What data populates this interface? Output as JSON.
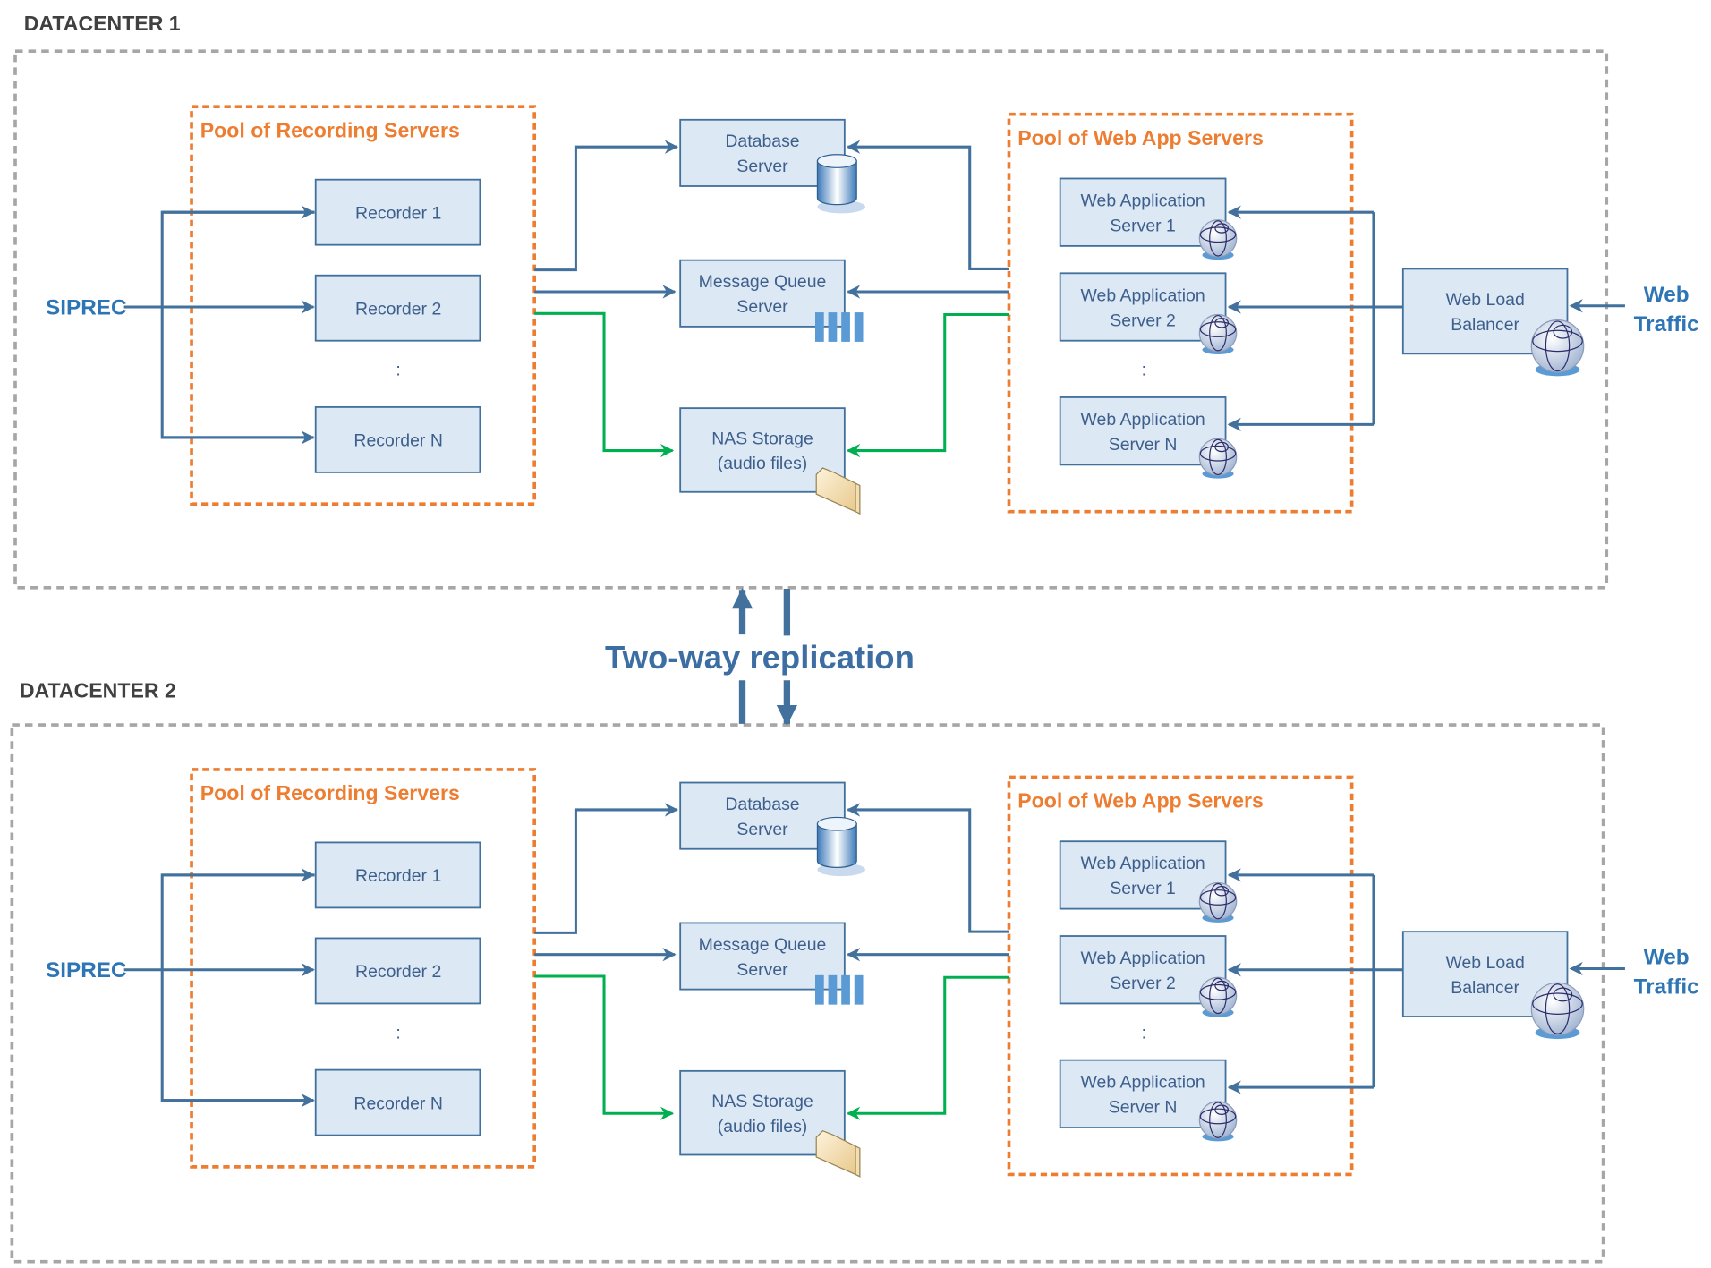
{
  "replication_label": "Two-way replication",
  "colors": {
    "connector_blue": "#41719c",
    "connector_green": "#00b050",
    "pool_border_orange": "#ed7d31",
    "datacenter_border_gray": "#a6a6a6",
    "box_fill": "#dde8f5",
    "label_blue": "#2e75b6"
  },
  "datacenters": [
    {
      "label": "DATACENTER 1",
      "siprec": "SIPREC",
      "web_traffic": [
        "Web",
        "Traffic"
      ],
      "recording_pool": {
        "title": "Pool of Recording Servers",
        "recorders": [
          "Recorder 1",
          "Recorder 2",
          "Recorder N"
        ],
        "ellipsis": ":"
      },
      "database": {
        "lines": [
          "Database",
          "Server"
        ],
        "icon": "database-cylinder-icon"
      },
      "message_queue": {
        "lines": [
          "Message Queue",
          "Server"
        ],
        "icon": "queue-bars-icon"
      },
      "nas": {
        "lines": [
          "NAS Storage",
          "(audio files)"
        ],
        "icon": "folder-icon"
      },
      "web_pool": {
        "title": "Pool of Web App Servers",
        "servers": [
          [
            "Web Application",
            "Server 1"
          ],
          [
            "Web Application",
            "Server 2"
          ],
          [
            "Web Application",
            "Server N"
          ]
        ],
        "ellipsis": ":",
        "icon": "globe-icon"
      },
      "load_balancer": {
        "lines": [
          "Web Load",
          "Balancer"
        ],
        "icon": "globe-icon"
      }
    },
    {
      "label": "DATACENTER 2",
      "siprec": "SIPREC",
      "web_traffic": [
        "Web",
        "Traffic"
      ],
      "recording_pool": {
        "title": "Pool of Recording Servers",
        "recorders": [
          "Recorder 1",
          "Recorder 2",
          "Recorder N"
        ],
        "ellipsis": ":"
      },
      "database": {
        "lines": [
          "Database",
          "Server"
        ],
        "icon": "database-cylinder-icon"
      },
      "message_queue": {
        "lines": [
          "Message Queue",
          "Server"
        ],
        "icon": "queue-bars-icon"
      },
      "nas": {
        "lines": [
          "NAS Storage",
          "(audio files)"
        ],
        "icon": "folder-icon"
      },
      "web_pool": {
        "title": "Pool of Web App Servers",
        "servers": [
          [
            "Web Application",
            "Server 1"
          ],
          [
            "Web Application",
            "Server 2"
          ],
          [
            "Web Application",
            "Server N"
          ]
        ],
        "ellipsis": ":",
        "icon": "globe-icon"
      },
      "load_balancer": {
        "lines": [
          "Web Load",
          "Balancer"
        ],
        "icon": "globe-icon"
      }
    }
  ]
}
